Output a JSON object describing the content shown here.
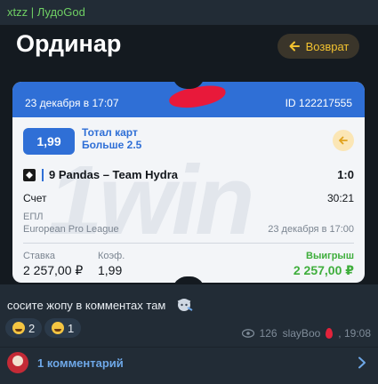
{
  "message": {
    "header": "xtzz | ЛудоGod",
    "caption": "сосите жопу в комментах там",
    "reactions": [
      {
        "emoji": "grin-emoji",
        "count": "2"
      },
      {
        "emoji": "rofl-emoji",
        "count": "1"
      }
    ],
    "views": "126",
    "author": "slayBoo",
    "time": ", 19:08",
    "comments_label": "1 комментарий"
  },
  "bet_screen": {
    "title": "Ординар",
    "back_label": "Возврат",
    "ticket": {
      "date": "23 декабря в 17:07",
      "id": "ID 122217555",
      "watermark": "1win",
      "odds": "1,99",
      "market_line1": "Тотал карт",
      "market_line2": "Больше 2.5",
      "teams": "9 Pandas – Team Hydra",
      "score": "1:0",
      "timer_label": "Счет",
      "timer_value": "30:21",
      "league_short": "ЕПЛ",
      "league_full": "European Pro League",
      "match_date": "23 декабря в 17:00",
      "stake_label": "Ставка",
      "stake_value": "2 257,00 ₽",
      "coef_label": "Коэф.",
      "coef_value": "1,99",
      "win_label": "Выигрыш",
      "win_value": "2 257,00 ₽"
    }
  },
  "colors": {
    "accent_blue": "#2f6fd6",
    "win_green": "#3fae3c",
    "back_yellow": "#f2c230",
    "link_blue": "#6ea8e8"
  }
}
